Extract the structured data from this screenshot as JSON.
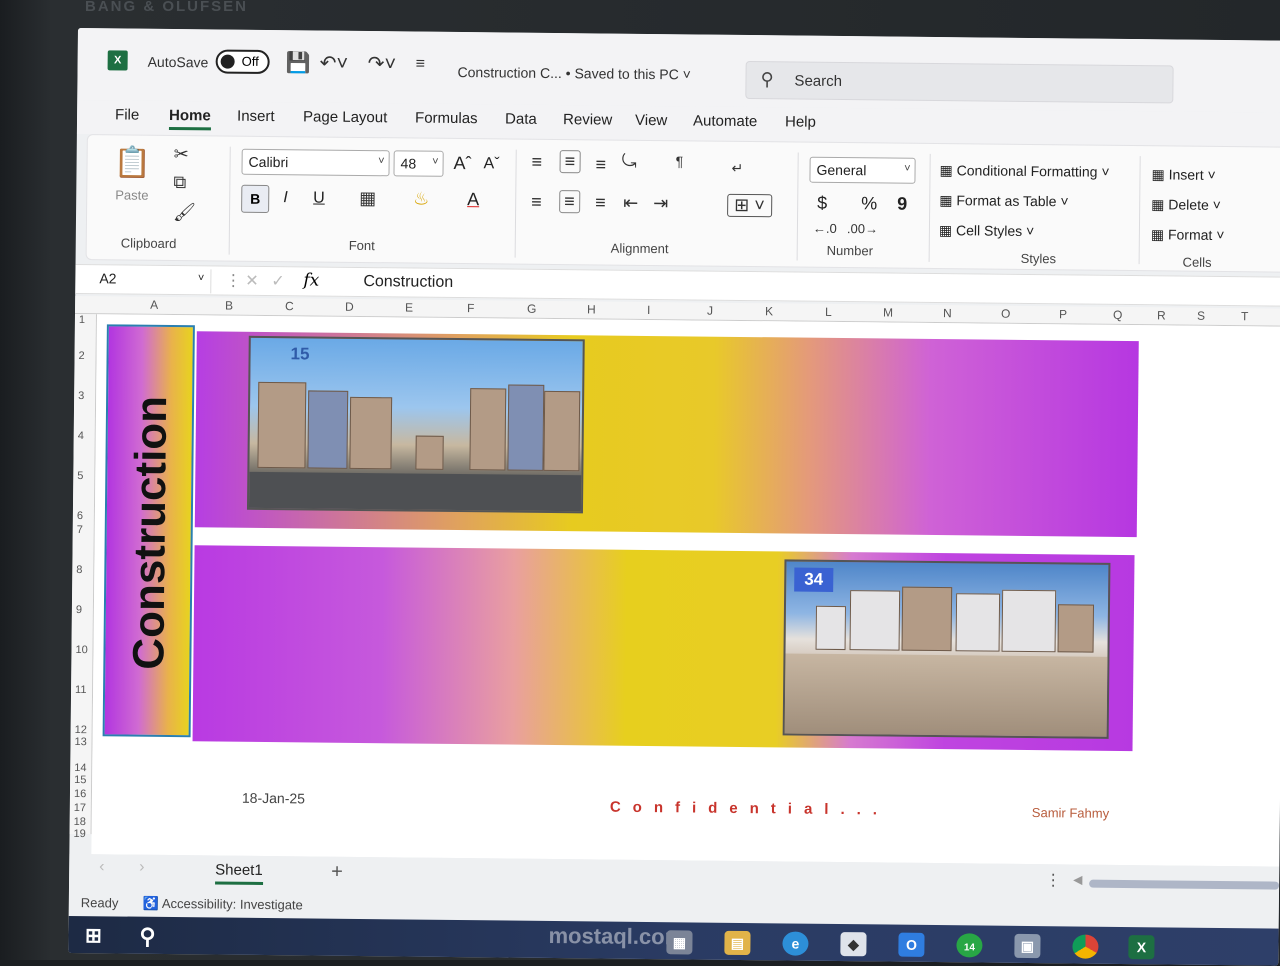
{
  "bezel": {
    "brand": "BANG & OLUFSEN"
  },
  "titlebar": {
    "app_icon": "X",
    "autosave_label": "AutoSave",
    "autosave_state": "Off",
    "doc_title": "Construction C...  •  Saved to this PC",
    "search_placeholder": "Search"
  },
  "tabs": [
    "File",
    "Home",
    "Insert",
    "Page Layout",
    "Formulas",
    "Data",
    "Review",
    "View",
    "Automate",
    "Help"
  ],
  "ribbon": {
    "clipboard": {
      "paste": "Paste",
      "label": "Clipboard"
    },
    "font": {
      "name": "Calibri",
      "size": "48",
      "bold": "B",
      "italic": "I",
      "underline": "U",
      "label": "Font"
    },
    "alignment": {
      "label": "Alignment"
    },
    "number": {
      "format": "General",
      "currency": "$",
      "percent": "%",
      "comma": "9",
      "label": "Number"
    },
    "styles": {
      "conditional": "Conditional Formatting",
      "table": "Format as Table",
      "cell_styles": "Cell Styles",
      "label": "Styles"
    },
    "cells": {
      "insert": "Insert",
      "delete": "Delete",
      "format": "Format",
      "label": "Cells"
    }
  },
  "formula_bar": {
    "name_box": "A2",
    "fx": "fx",
    "value": "Construction"
  },
  "columns": [
    "A",
    "B",
    "C",
    "D",
    "E",
    "F",
    "G",
    "H",
    "I",
    "J",
    "K",
    "L",
    "M",
    "N",
    "O",
    "P",
    "Q",
    "R",
    "S",
    "T"
  ],
  "rows": [
    "1",
    "2",
    "3",
    "4",
    "5",
    "6",
    "7",
    "8",
    "9",
    "10",
    "11",
    "12",
    "13",
    "14",
    "15",
    "16",
    "17",
    "18",
    "19"
  ],
  "sheet": {
    "side_title": "Construction",
    "photo1_badge": "15",
    "photo2_badge": "34",
    "footer_date": "18-Jan-25",
    "footer_confidential": "Confidential...",
    "footer_author": "Samir Fahmy"
  },
  "sheet_tabs": {
    "active": "Sheet1",
    "add": "+"
  },
  "status": {
    "ready": "Ready",
    "accessibility": "Accessibility: Investigate"
  },
  "taskbar": {
    "watermark": "mostaql.com",
    "badge": "14"
  },
  "colors": {
    "excel_green": "#1d6f42",
    "purple": "#b637e1",
    "yellow": "#e7cf1e",
    "confidential_red": "#c8342c"
  }
}
